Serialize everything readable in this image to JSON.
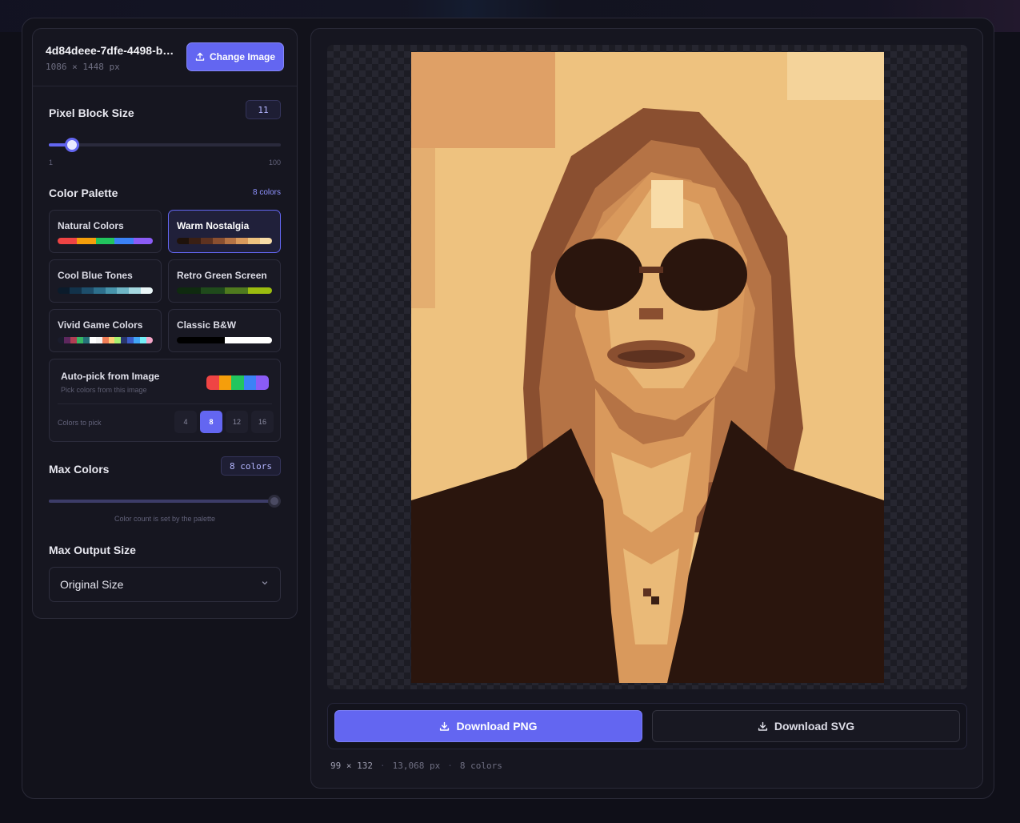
{
  "file": {
    "name": "4d84deee-7dfe-4498-b…",
    "dimensions": "1086 × 1448 px",
    "change_label": "Change Image"
  },
  "pixel_block": {
    "label": "Pixel Block Size",
    "value": "11",
    "min": "1",
    "max": "100",
    "fraction": 0.1
  },
  "palette": {
    "label": "Color Palette",
    "count_label": "8 colors",
    "options": [
      {
        "name": "Natural Colors",
        "colors": [
          "#ef4444",
          "#f59e0b",
          "#22c55e",
          "#3b82f6",
          "#8b5cf6"
        ],
        "active": false
      },
      {
        "name": "Warm Nostalgia",
        "colors": [
          "#1f120b",
          "#3a1f14",
          "#5e3220",
          "#8a4f30",
          "#b57345",
          "#d9995c",
          "#eec27f",
          "#f8dca8"
        ],
        "active": true
      },
      {
        "name": "Cool Blue Tones",
        "colors": [
          "#0b1b2b",
          "#12324a",
          "#1d4e6b",
          "#2d6f8c",
          "#4794ab",
          "#6fb6c6",
          "#a5d8e0",
          "#eaf6f8"
        ],
        "active": false
      },
      {
        "name": "Retro Green Screen",
        "colors": [
          "#0f2a0f",
          "#1f4a1b",
          "#4f7a1e",
          "#9bbc0f"
        ],
        "active": false
      },
      {
        "name": "Vivid Game Colors",
        "colors": [
          "#1a1c2c",
          "#5d275d",
          "#b13e53",
          "#38b764",
          "#257179",
          "#ffffff",
          "#f4f4f4",
          "#ef7d57",
          "#ffcd75",
          "#a7f070",
          "#29366f",
          "#3b5dc9",
          "#41a6f6",
          "#73eff7",
          "#f4a6c8"
        ],
        "active": false
      },
      {
        "name": "Classic B&W",
        "colors": [
          "#000000",
          "#000000",
          "#ffffff",
          "#ffffff"
        ],
        "active": false
      }
    ]
  },
  "auto_pick": {
    "title": "Auto-pick from Image",
    "subtitle": "Pick colors from this image",
    "colors_label": "Colors to pick",
    "swatch": [
      "#ef4444",
      "#f59e0b",
      "#22c55e",
      "#3b82f6",
      "#8b5cf6"
    ],
    "counts": [
      "4",
      "8",
      "12",
      "16"
    ],
    "selected": "8"
  },
  "max_colors": {
    "label": "Max Colors",
    "value": "8 colors",
    "fraction": 1.0,
    "hint": "Color count is set by the palette"
  },
  "output_size": {
    "label": "Max Output Size",
    "selected": "Original Size"
  },
  "downloads": {
    "png_label": "Download PNG",
    "svg_label": "Download SVG"
  },
  "stats": {
    "grid": "99 × 132",
    "pixels": "13,068 px",
    "colors": "8 colors"
  }
}
